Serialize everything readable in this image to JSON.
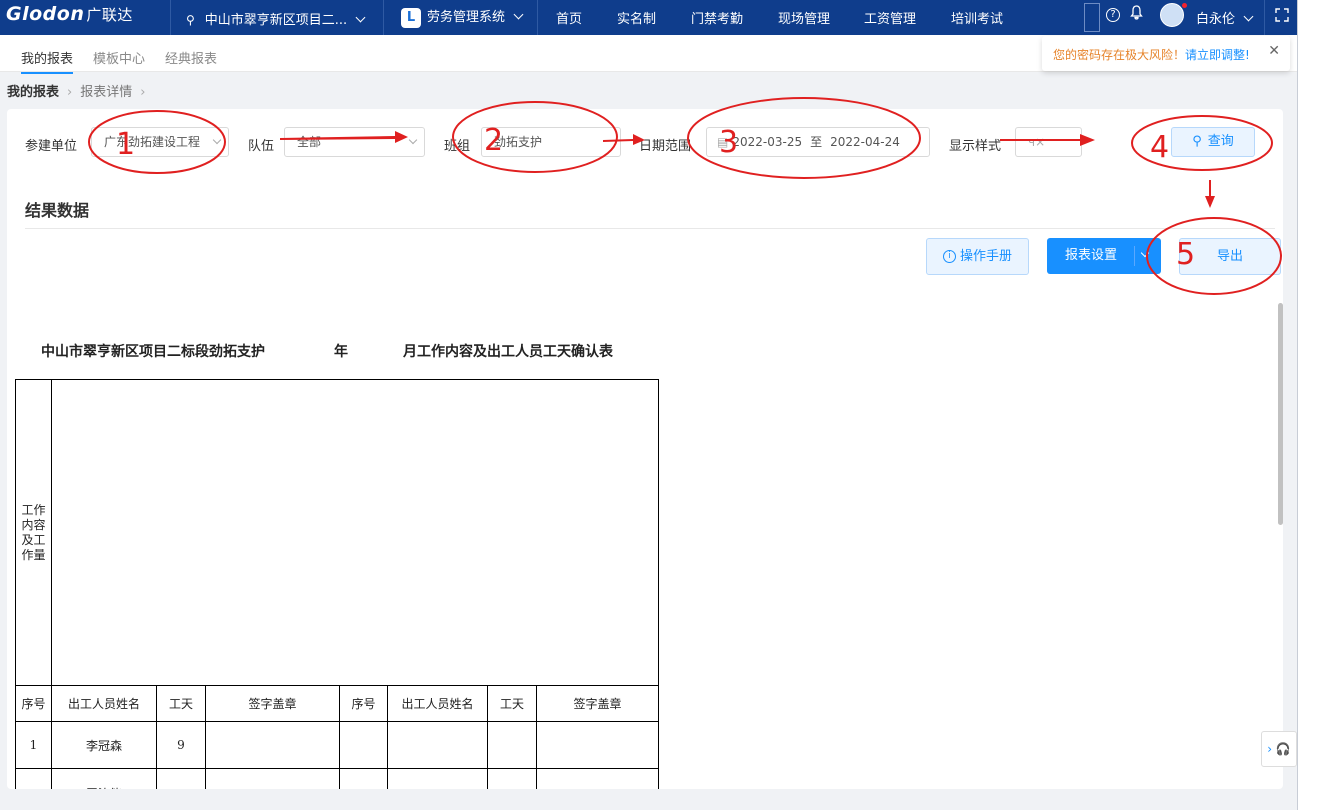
{
  "topbar": {
    "logo": "Glodon",
    "logo_cn": "广联达",
    "project": "中山市翠亨新区项目二...",
    "system": "劳务管理系统",
    "system_badge": "L",
    "nav": [
      "首页",
      "实名制",
      "门禁考勤",
      "现场管理",
      "工资管理",
      "培训考试"
    ],
    "help_icon": "?",
    "bell_icon": "bell-icon",
    "user": "白永伦",
    "fullscreen_icon": "fullscreen-icon"
  },
  "tabs": [
    "我的报表",
    "模板中心",
    "经典报表"
  ],
  "notice": {
    "text": "您的密码存在极大风险！",
    "link": "请立即调整!",
    "close": "✕"
  },
  "breadcrumb": {
    "root": "我的报表",
    "current": "报表详情"
  },
  "filters": {
    "unit_label": "参建单位",
    "unit_value": "广东劲拓建设工程",
    "team_label": "队伍",
    "team_value": "全部",
    "group_label": "班组",
    "group_value": "劲拓支护",
    "date_label": "日期范围",
    "date_start": "2022-03-25",
    "date_to": "至",
    "date_end": "2022-04-24",
    "style_label": "显示样式",
    "style_value": "ч×",
    "query_button": "查询"
  },
  "result": {
    "title": "结果数据",
    "manual_button": "操作手册",
    "setting_button": "报表设置",
    "export_button": "导出"
  },
  "report": {
    "title_a": "中山市翠亨新区项目二标段劲拓支护",
    "title_b": "年",
    "title_c": "月工作内容及出工人员工天确认表",
    "work_label": "工作内容及工作量",
    "headers": [
      "序号",
      "出工人员姓名",
      "工天",
      "签字盖章",
      "序号",
      "出工人员姓名",
      "工天",
      "签字盖章"
    ],
    "rows": [
      {
        "no": "1",
        "name": "李冠森",
        "days": "9"
      },
      {
        "no": "",
        "name": "罗汝能",
        "days": ""
      }
    ]
  },
  "annotations": [
    "1",
    "2",
    "3",
    "4",
    "5"
  ],
  "colors": {
    "topbar": "#0f3d8c",
    "accent": "#1890ff",
    "annotation": "#e02020",
    "warning": "#e6832a"
  }
}
